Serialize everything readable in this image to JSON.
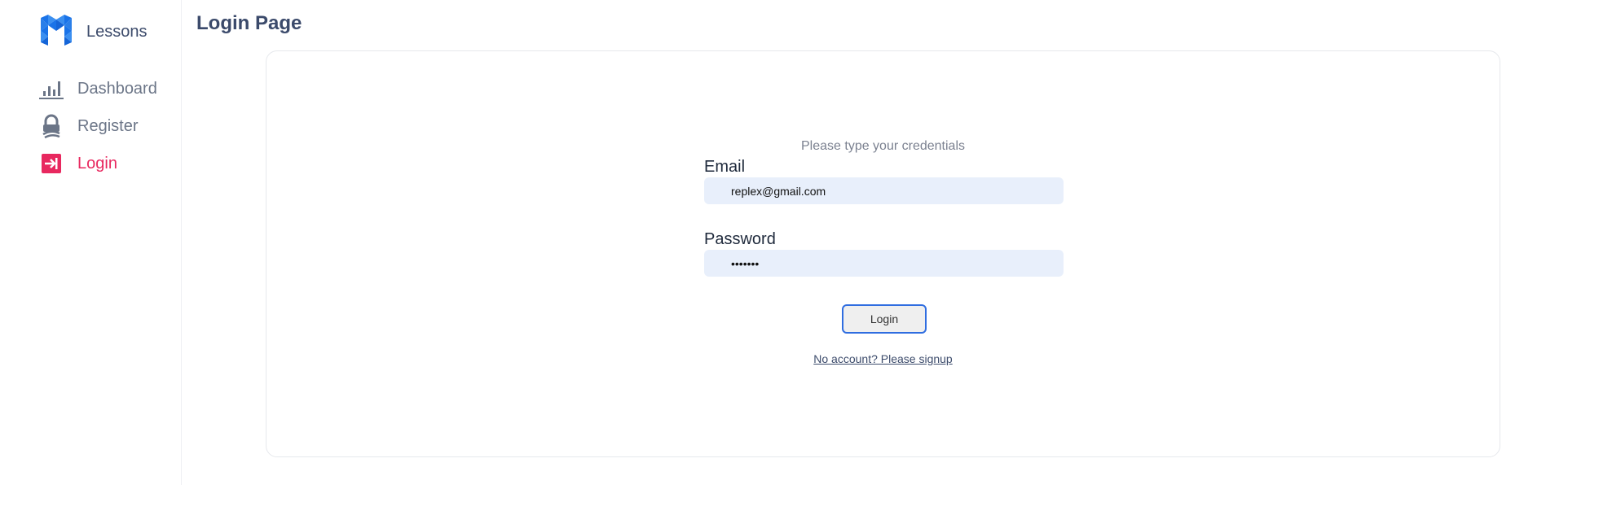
{
  "sidebar": {
    "brand": {
      "label": "Lessons",
      "icon": "logo-icon"
    },
    "items": [
      {
        "label": "Dashboard",
        "icon": "bar-chart-icon",
        "active": false
      },
      {
        "label": "Register",
        "icon": "user-lock-icon",
        "active": false
      },
      {
        "label": "Login",
        "icon": "login-icon",
        "active": true
      }
    ]
  },
  "main": {
    "title": "Login Page",
    "form": {
      "subtitle": "Please type your credentials",
      "email": {
        "label": "Email",
        "value": "replex@gmail.com"
      },
      "password": {
        "label": "Password",
        "value": "•••••••"
      },
      "submit_label": "Login",
      "signup_link": "No account? Please signup"
    }
  },
  "colors": {
    "brand_blue": "#1a73e8",
    "active_pink": "#e8285f",
    "title_navy": "#3b4a6b",
    "input_bg": "#e8effb",
    "button_border": "#2f6de0"
  }
}
